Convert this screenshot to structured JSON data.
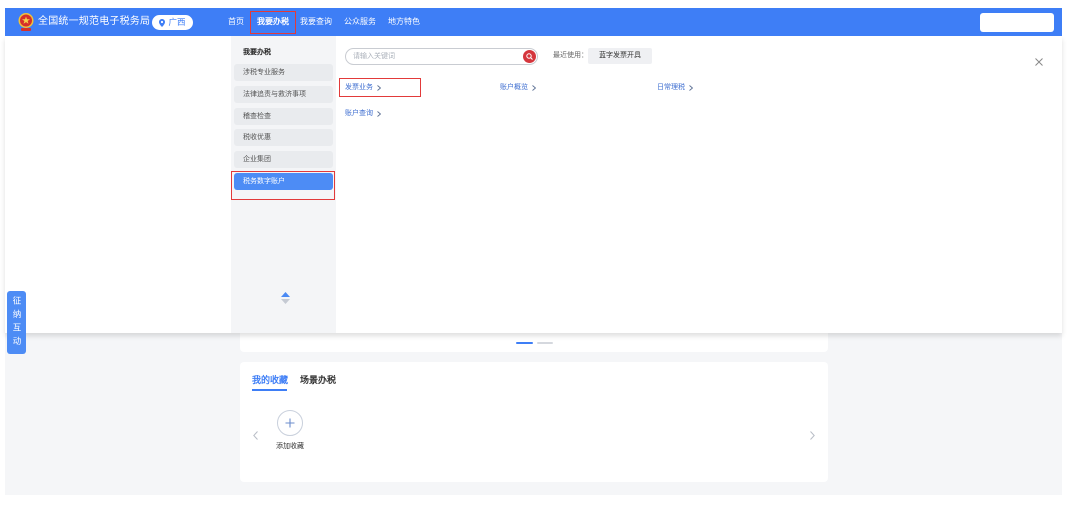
{
  "colors": {
    "primary": "#3e7ef6",
    "highlight": "#e23a3a",
    "active_item": "#4d8cf5",
    "search_button": "#d5363d",
    "link": "#3f6fd1"
  },
  "header": {
    "emblem_icon": "national-emblem-icon",
    "title": "全国统一规范电子税务局",
    "region": {
      "icon": "location-pin-icon",
      "label": "广西"
    },
    "nav": [
      {
        "label": "首页"
      },
      {
        "label": "我要办税",
        "active": true
      },
      {
        "label": "我要查询"
      },
      {
        "label": "公众服务"
      },
      {
        "label": "地方特色"
      }
    ]
  },
  "menu": {
    "heading": "我要办税",
    "items": [
      {
        "label": "涉税专业服务"
      },
      {
        "label": "法律追责与救济事项"
      },
      {
        "label": "稽查检查"
      },
      {
        "label": "税收优惠"
      },
      {
        "label": "企业集团"
      },
      {
        "label": "税务数字账户",
        "active": true
      }
    ],
    "scroll_icon": "scroll-up-down-icon"
  },
  "search": {
    "placeholder": "请输入关键词",
    "icon": "search-icon"
  },
  "recent": {
    "label": "最近使用：",
    "items": [
      {
        "label": "蓝字发票开具"
      }
    ]
  },
  "links": [
    {
      "label": "发票业务"
    },
    {
      "label": "账户概览"
    },
    {
      "label": "日常理税"
    },
    {
      "label": "账户查询"
    }
  ],
  "close_icon": "close-icon",
  "side_tab": {
    "label": "征纳互动"
  },
  "carousel": {
    "slides": 2,
    "active_index": 0
  },
  "favorites": {
    "tabs": [
      {
        "label": "我的收藏",
        "active": true
      },
      {
        "label": "场景办税"
      }
    ],
    "add": {
      "icon": "plus-icon",
      "label": "添加收藏"
    },
    "prev_icon": "chevron-left-icon",
    "next_icon": "chevron-right-icon"
  }
}
